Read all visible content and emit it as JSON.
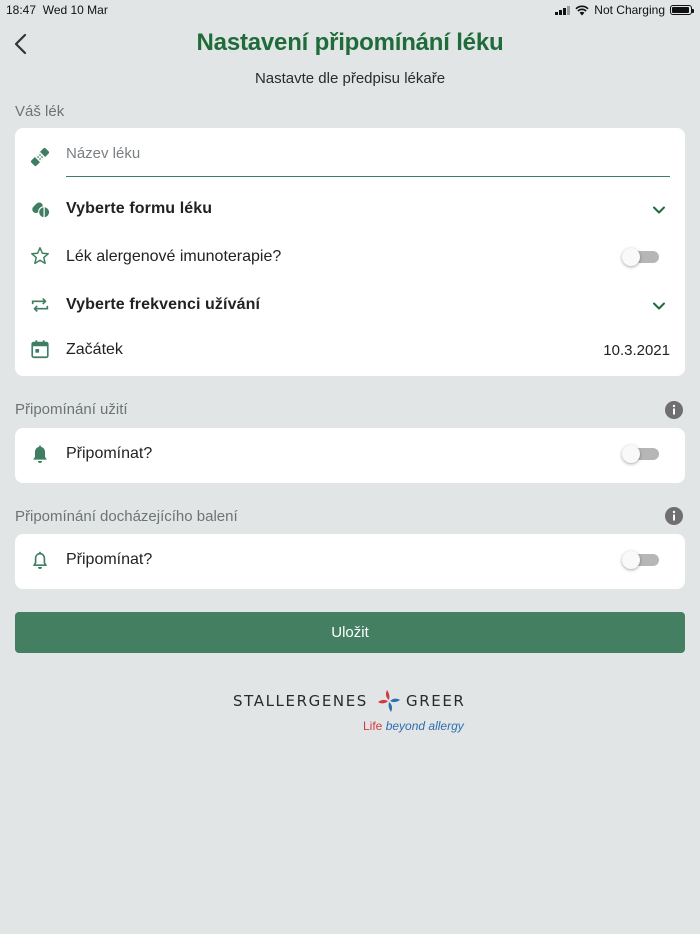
{
  "status_bar": {
    "time": "18:47",
    "date": "Wed 10 Mar",
    "charging": "Not Charging",
    "battery_level": 0.95
  },
  "header": {
    "title": "Nastavení připomínání léku",
    "subtitle": "Nastavte dle předpisu lékaře"
  },
  "medication": {
    "section_label": "Váš lék",
    "name_placeholder": "Název léku",
    "name_value": "",
    "form_label": "Vyberte formu léku",
    "allergen_label": "Lék alergenové imunoterapie?",
    "allergen_on": false,
    "frequency_label": "Vyberte frekvenci užívání",
    "start_label": "Začátek",
    "start_date": "10.3.2021"
  },
  "intake_reminder": {
    "section_label": "Připomínání užití",
    "toggle_label": "Připomínat?",
    "enabled": false
  },
  "package_reminder": {
    "section_label": "Připomínání docházejícího balení",
    "toggle_label": "Připomínat?",
    "enabled": false
  },
  "actions": {
    "save_label": "Uložit"
  },
  "branding": {
    "brand_left": "STALLERGENES",
    "brand_right": "GREER",
    "tagline_life": "Life",
    "tagline_rest": "beyond allergy"
  },
  "colors": {
    "background": "#e1e5e6",
    "accent_green": "#1f6b3a",
    "icon_green": "#3f7e62",
    "button_green": "#447f61",
    "brand_red": "#d33a3f",
    "brand_blue": "#2f6db1"
  }
}
